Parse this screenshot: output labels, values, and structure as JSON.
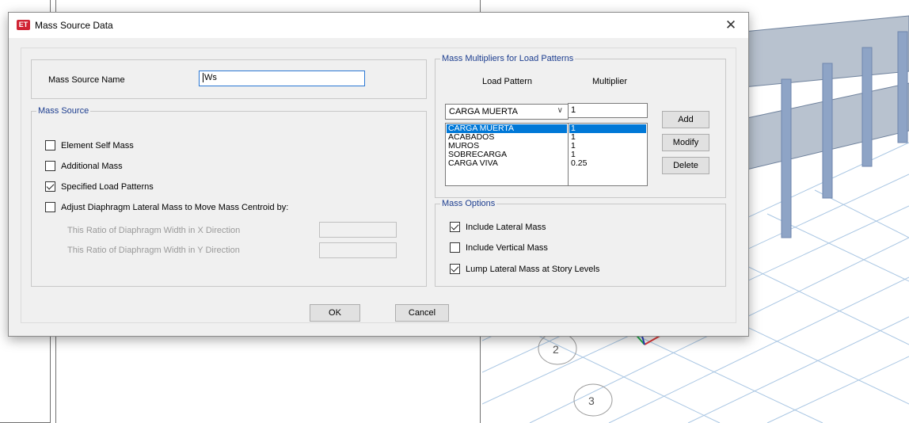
{
  "dialog": {
    "app_badge": "ET",
    "title": "Mass Source Data",
    "close_symbol": "✕"
  },
  "name_row": {
    "label": "Mass Source Name",
    "value": "Ws"
  },
  "mass_source": {
    "legend": "Mass Source",
    "element_self_mass": {
      "label": "Element Self Mass",
      "checked": false
    },
    "additional_mass": {
      "label": "Additional Mass",
      "checked": false
    },
    "specified_load_patterns": {
      "label": "Specified Load Patterns",
      "checked": true
    },
    "adjust_diaphragm": {
      "label": "Adjust Diaphragm Lateral Mass to Move Mass Centroid by:",
      "checked": false
    },
    "ratio_x_label": "This Ratio of Diaphragm Width in X Direction",
    "ratio_y_label": "This Ratio of Diaphragm Width in Y Direction",
    "ratio_x_value": "",
    "ratio_y_value": ""
  },
  "multipliers": {
    "legend": "Mass Multipliers for Load Patterns",
    "col_load_pattern": "Load Pattern",
    "col_multiplier": "Multiplier",
    "selected_pattern": "CARGA MUERTA",
    "multiplier_value": "1",
    "patterns": [
      "CARGA MUERTA",
      "ACABADOS",
      "MUROS",
      "SOBRECARGA",
      "CARGA VIVA"
    ],
    "values": [
      "1",
      "1",
      "1",
      "1",
      "0.25"
    ],
    "add_label": "Add",
    "modify_label": "Modify",
    "delete_label": "Delete"
  },
  "mass_options": {
    "legend": "Mass Options",
    "include_lateral": {
      "label": "Include Lateral Mass",
      "checked": true
    },
    "include_vertical": {
      "label": "Include Vertical Mass",
      "checked": false
    },
    "lump_lateral": {
      "label": "Lump Lateral Mass at Story Levels",
      "checked": true
    }
  },
  "footer": {
    "ok_label": "OK",
    "cancel_label": "Cancel"
  },
  "viewport": {
    "grid_bubble_labels": [
      "2",
      "3"
    ]
  }
}
